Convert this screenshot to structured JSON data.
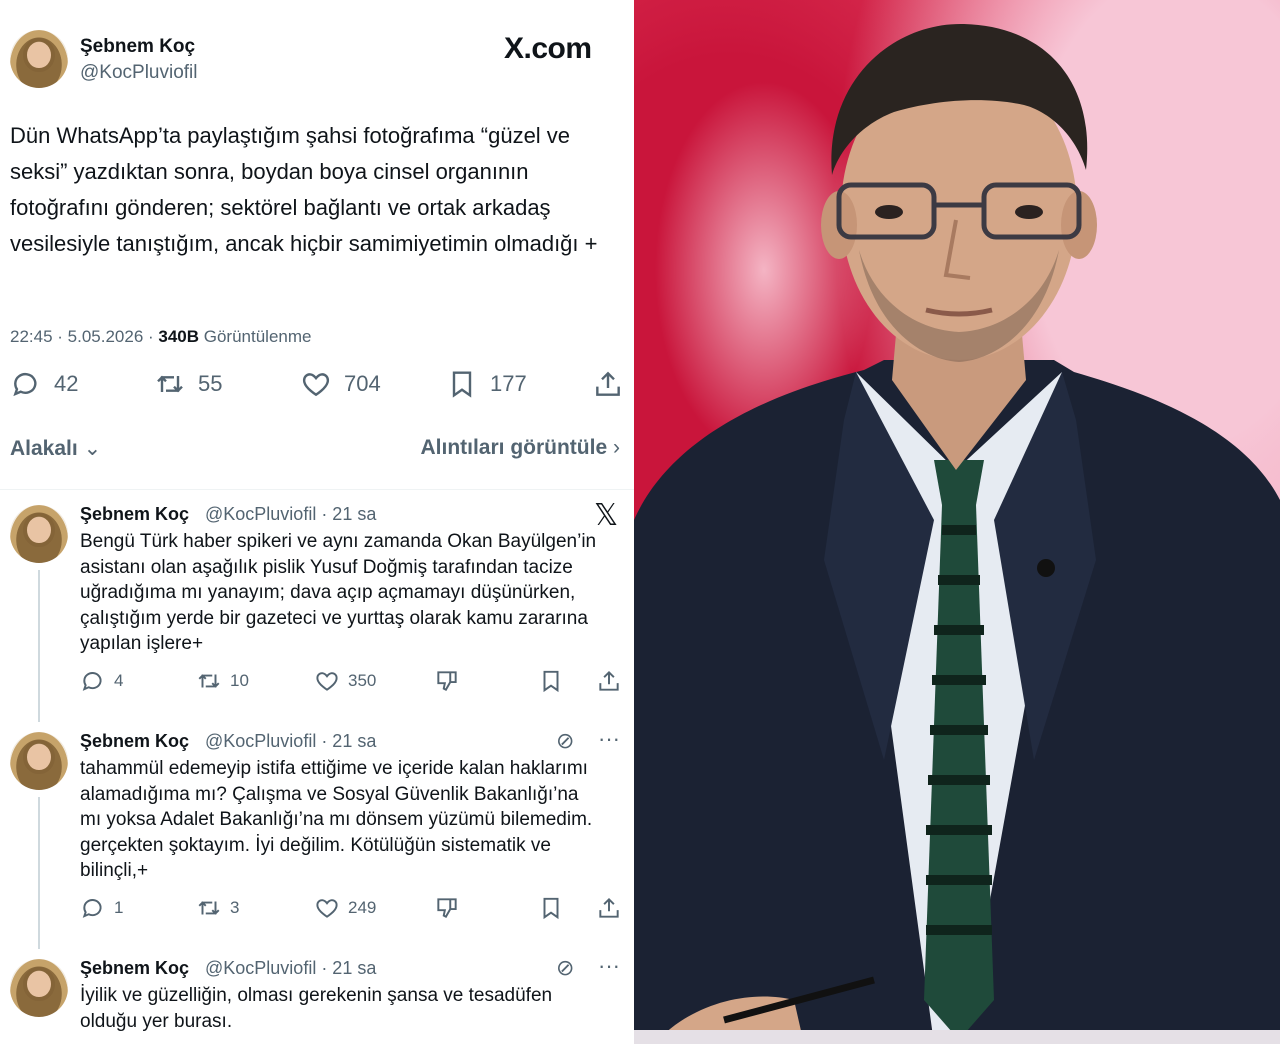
{
  "tweet": {
    "author_name": "Şebnem Koç",
    "author_handle": "@KocPluviofil",
    "brand": "X.com",
    "text": "Dün WhatsApp’ta paylaştığım şahsi fotoğrafıma “güzel ve seksi” yazdıktan sonra, boydan boya cinsel organının fotoğrafını gönderen; sektörel bağlantı ve ortak arkadaş vesilesiyle tanıştığım, ancak hiçbir samimiyetimin olmadığı +",
    "time": "22:45 · 5.05.2026 · ",
    "views_count": "340B",
    "views_label": " Görüntülenme",
    "replies": "42",
    "reposts": "55",
    "likes": "704",
    "bookmarks": "177",
    "related_label": "Alakalı",
    "quotes_label": "Alıntıları görüntüle"
  },
  "replies": [
    {
      "name": "Şebnem Koç",
      "meta": "@KocPluviofil · 21 sa",
      "text": "Bengü Türk haber spikeri ve aynı zamanda Okan Bayülgen’in asistanı olan aşağılık pislik Yusuf Doğmiş tarafından tacize uğradığıma mı yanayım; dava açıp açmamayı düşünürken, çalıştığım yerde bir gazeteci ve yurttaş olarak kamu zararına yapılan işlere+",
      "replies": "4",
      "reposts": "10",
      "likes": "350"
    },
    {
      "name": "Şebnem Koç",
      "meta": "@KocPluviofil · 21 sa",
      "text": "tahammül edemeyip istifa ettiğime ve içeride kalan haklarımı alamadığıma mı? Çalışma ve Sosyal Güvenlik Bakanlığı’na mı yoksa Adalet Bakanlığı’na mı dönsem yüzümü bilemedim. gerçekten şoktayım. İyi değilim. Kötülüğün sistematik ve bilinçli,+",
      "replies": "1",
      "reposts": "3",
      "likes": "249"
    },
    {
      "name": "Şebnem Koç",
      "meta": "@KocPluviofil · 21 sa",
      "text": "İyilik ve güzelliğin, olması gerekenin şansa ve tesadüfen olduğu yer burası."
    }
  ],
  "icons": {
    "reply": "reply-icon",
    "repost": "repost-icon",
    "like": "heart-icon",
    "bookmark": "bookmark-icon",
    "share": "share-icon",
    "dislike": "dislike-icon",
    "grok": "grok-icon",
    "more": "more-icon"
  }
}
